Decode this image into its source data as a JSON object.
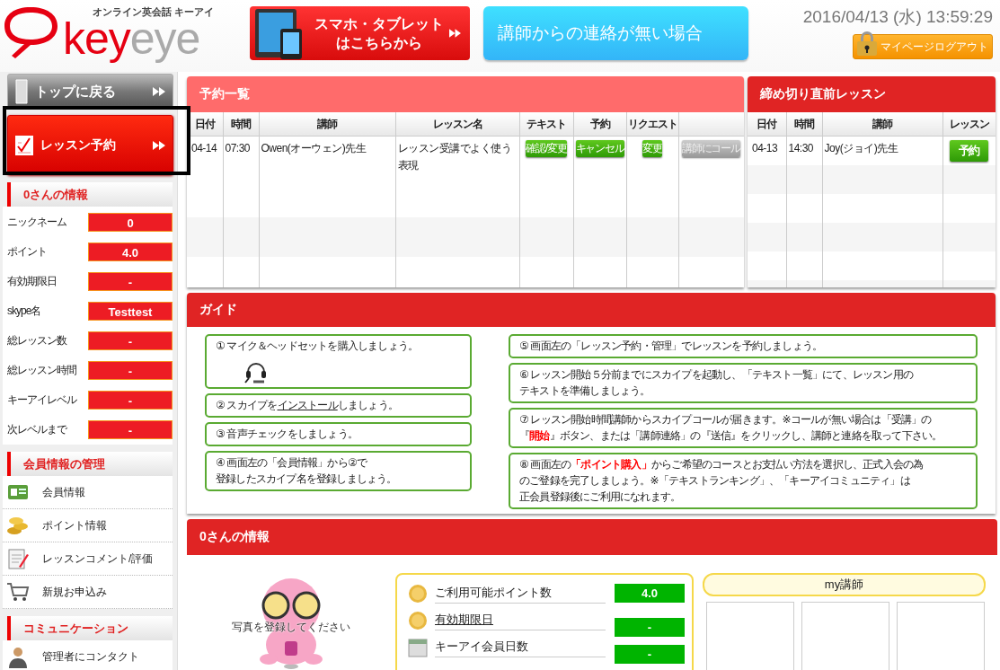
{
  "header": {
    "logo": {
      "tagline": "オンライン英会話 キーアイ",
      "wordmark_key": "key",
      "wordmark_eye": "eye"
    },
    "mobile_button": {
      "lines": [
        "スマホ・タブレット",
        "はこちらから"
      ]
    },
    "no_contact_button": {
      "label": "講師からの連絡が無い場合"
    },
    "datetime": "2016/04/13 (水) 13:59:29",
    "logout_button": {
      "label": "マイページログアウト"
    }
  },
  "sidebar": {
    "top_button": {
      "label": "トップに戻る"
    },
    "reserve_button": {
      "label": "レッスン予約"
    },
    "info": {
      "title": "0さんの情報",
      "rows": [
        {
          "label": "ニックネーム",
          "value": "0"
        },
        {
          "label": "ポイント",
          "value": "4.0"
        },
        {
          "label": "有効期限日",
          "value": "-"
        },
        {
          "label": "skype名",
          "value": "Testtest"
        },
        {
          "label": "総レッスン数",
          "value": "-"
        },
        {
          "label": "総レッスン時間",
          "value": "-"
        },
        {
          "label": "キーアイレベル",
          "value": "-"
        },
        {
          "label": "次レベルまで",
          "value": "-"
        }
      ]
    },
    "sections": [
      {
        "title": "会員情報の管理",
        "items": [
          {
            "label": "会員情報",
            "kind": "card"
          },
          {
            "label": "ポイント情報",
            "kind": "coins"
          },
          {
            "label": "レッスンコメント/評価",
            "kind": "note"
          },
          {
            "label": "新規お申込み",
            "kind": "cart"
          }
        ]
      },
      {
        "title": "コミュニケーション",
        "items": [
          {
            "label": "管理者にコンタクト",
            "kind": "person"
          }
        ]
      }
    ]
  },
  "reservations": {
    "title": "予約一覧",
    "columns": [
      "日付",
      "時間",
      "講師",
      "レッスン名",
      "テキスト",
      "予約",
      "リクエスト"
    ],
    "rows": [
      {
        "date": "04-14",
        "time": "07:30",
        "teacher": "Owen(オーウェン)先生",
        "lesson": "レッスン受講でよく使う表現",
        "buttons": [
          {
            "label": "確認/変更",
            "disabled": false
          },
          {
            "label": "キャンセル",
            "disabled": false
          },
          {
            "label": "変更",
            "disabled": false
          },
          {
            "label": "講師にコール",
            "disabled": true
          }
        ]
      }
    ]
  },
  "deadline": {
    "title": "締め切り直前レッスン",
    "columns": [
      "日付",
      "時間",
      "講師",
      "レッスン"
    ],
    "rows": [
      {
        "date": "04-13",
        "time": "14:30",
        "teacher": "Joy(ジョイ)先生",
        "button": "予約"
      }
    ]
  },
  "guide": {
    "title": "ガイド",
    "left": [
      {
        "kind": "illustrated",
        "text": "① マイク＆ヘッドセットを購入しましょう。"
      },
      {
        "kind": "link",
        "before": "② スカイプを",
        "link": "インストール",
        "after": "しましょう。"
      },
      {
        "kind": "plain",
        "lines": [
          "③ 音声チェックをしましょう。"
        ]
      },
      {
        "kind": "plain",
        "lines": [
          "④ 画面左の「会員情報」から②で",
          "登録したスカイプ名を登録しましょう。"
        ]
      }
    ],
    "right": [
      {
        "kind": "plain",
        "lines": [
          "⑤ 画面左の「レッスン予約・管理」でレッスンを予約しましょう。"
        ]
      },
      {
        "kind": "plain",
        "lines": [
          "⑥ レッスン開始５分前までにスカイプを起動し、「テキスト一覧」にて、レッスン用の",
          "テキストを準備しましょう。"
        ]
      },
      {
        "kind": "plain",
        "lines": [
          "⑦ レッスン開始時間講師からスカイプコールが届きます。※コールが無い場合は「受講」の",
          "『**開始**』ボタン、または「講師連絡」の『送信』をクリックし、講師と連絡を取って下さい。"
        ]
      },
      {
        "kind": "plain",
        "lines": [
          "⑧ 画面左の**「ポイント購入」**からご希望のコースとお支払い方法を選択し、正式入会の為",
          "のご登録を完了しましょう。※「テキストランキング」、「キーアイコミュニティ」は",
          "正会員登録後にご利用になれます。"
        ]
      }
    ]
  },
  "member": {
    "title": "0さんの情報",
    "photo_caption": "写真を登録してください",
    "stats": [
      {
        "kind": "coin",
        "label": "ご利用可能ポイント数",
        "value": "4.0"
      },
      {
        "kind": "coin-link",
        "label": "有効期限日",
        "value": "-"
      },
      {
        "kind": "calendar",
        "label": "キーアイ会員日数",
        "value": "-"
      }
    ],
    "teachers_title": "my講師"
  }
}
